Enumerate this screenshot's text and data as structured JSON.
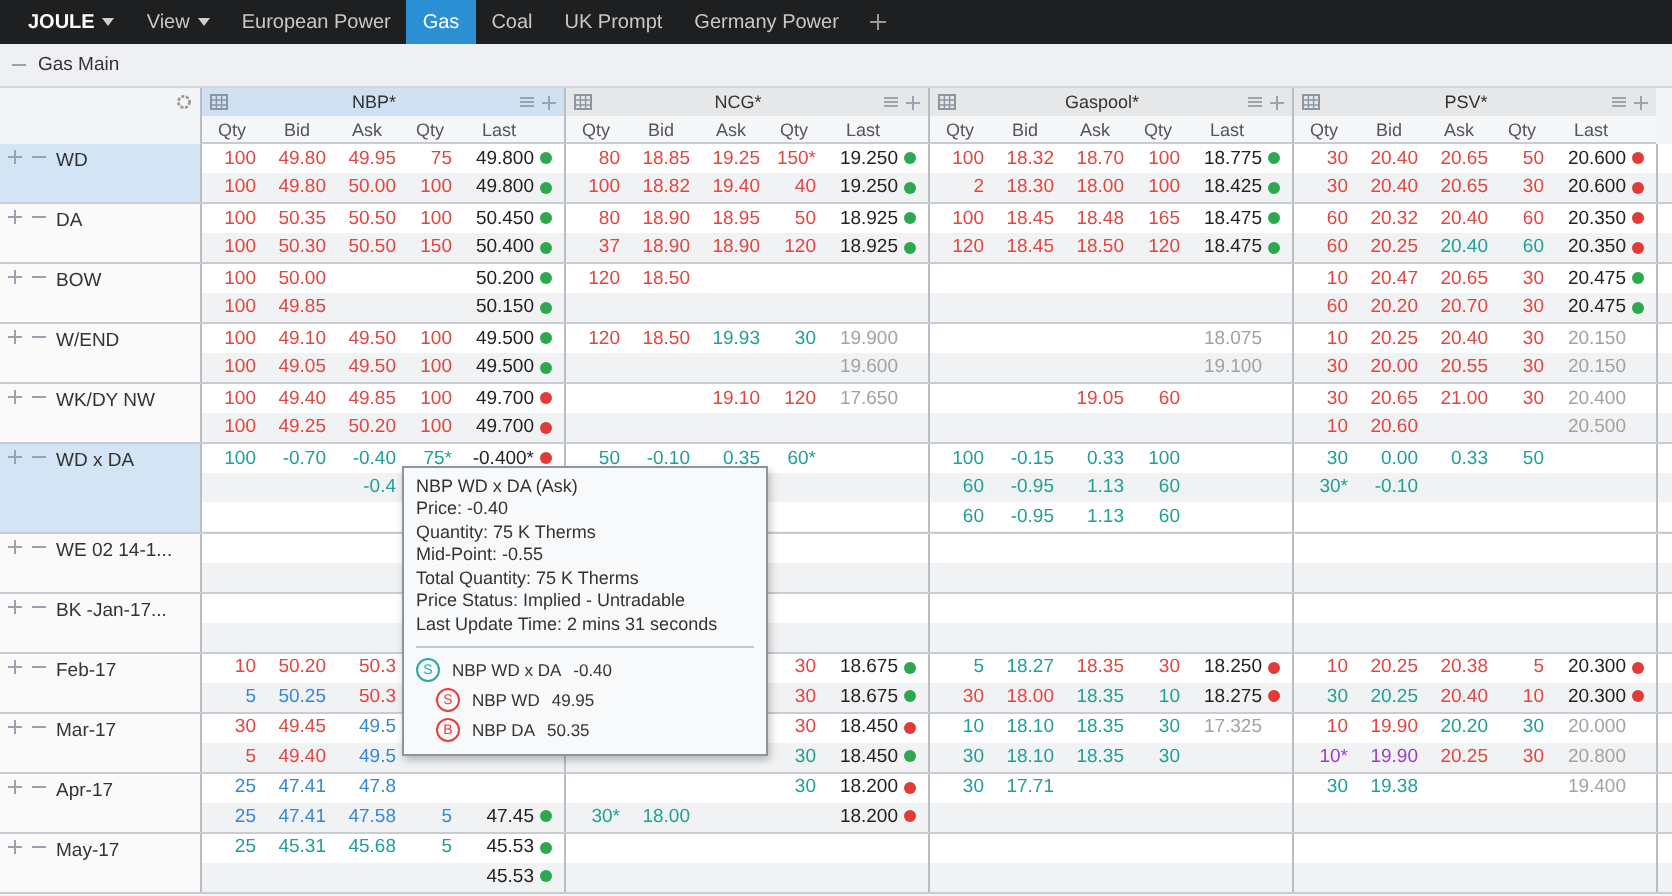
{
  "nav": [
    {
      "label": "JOULE",
      "kind": "brand",
      "selected": false
    },
    {
      "label": "View",
      "kind": "menu",
      "selected": false
    },
    {
      "label": "European Power",
      "kind": "tab",
      "selected": false
    },
    {
      "label": "Gas",
      "kind": "tab",
      "selected": true
    },
    {
      "label": "Coal",
      "kind": "tab",
      "selected": false
    },
    {
      "label": "UK Prompt",
      "kind": "tab",
      "selected": false
    },
    {
      "label": "Germany Power",
      "kind": "tab",
      "selected": false
    }
  ],
  "section": {
    "title": "Gas Main",
    "expanded": true
  },
  "hubs": [
    {
      "name": "NBP*",
      "selected": true,
      "columns": [
        "Qty",
        "Bid",
        "Ask",
        "Qty",
        "Last"
      ]
    },
    {
      "name": "NCG*",
      "selected": false,
      "columns": [
        "Qty",
        "Bid",
        "Ask",
        "Qty",
        "Last"
      ]
    },
    {
      "name": "Gaspool*",
      "selected": false,
      "columns": [
        "Qty",
        "Bid",
        "Ask",
        "Qty",
        "Last"
      ]
    },
    {
      "name": "PSV*",
      "selected": false,
      "columns": [
        "Qty",
        "Bid",
        "Ask",
        "Qty",
        "Last"
      ]
    }
  ],
  "products": [
    {
      "label": "WD",
      "selected": true,
      "rows": [
        [
          {
            "bid": {
              "qty": "100",
              "price": "49.80",
              "color": "#e3453f"
            },
            "ask": {
              "price": "49.95",
              "qty": "75",
              "color": "#e3453f"
            },
            "last": {
              "price": "49.800",
              "color": "#222222",
              "rising": true
            }
          },
          {
            "bid": {
              "qty": "80",
              "price": "18.85",
              "color": "#e3453f"
            },
            "ask": {
              "price": "19.25",
              "qty": "150*",
              "color": "#e3453f"
            },
            "last": {
              "price": "19.250",
              "color": "#222222",
              "rising": true
            }
          },
          {
            "bid": {
              "qty": "100",
              "price": "18.32",
              "color": "#e3453f"
            },
            "ask": {
              "price": "18.70",
              "qty": "100",
              "color": "#e3453f"
            },
            "last": {
              "price": "18.775",
              "color": "#222222",
              "rising": true
            }
          },
          {
            "bid": {
              "qty": "30",
              "price": "20.40",
              "color": "#e3453f"
            },
            "ask": {
              "price": "20.65",
              "qty": "50",
              "color": "#e3453f"
            },
            "last": {
              "price": "20.600",
              "color": "#222222",
              "rising": false
            }
          }
        ],
        [
          {
            "bid": {
              "qty": "100",
              "price": "49.80",
              "color": "#e3453f"
            },
            "ask": {
              "price": "50.00",
              "qty": "100",
              "color": "#e3453f"
            },
            "last": {
              "price": "49.800",
              "color": "#222222",
              "rising": true
            }
          },
          {
            "bid": {
              "qty": "100",
              "price": "18.82",
              "color": "#e3453f"
            },
            "ask": {
              "price": "19.40",
              "qty": "40",
              "color": "#e3453f"
            },
            "last": {
              "price": "19.250",
              "color": "#222222",
              "rising": true
            }
          },
          {
            "bid": {
              "qty": "2",
              "price": "18.30",
              "color": "#e3453f"
            },
            "ask": {
              "price": "18.00",
              "qty": "100",
              "color": "#e3453f"
            },
            "last": {
              "price": "18.425",
              "color": "#222222",
              "rising": true
            }
          },
          {
            "bid": {
              "qty": "30",
              "price": "20.40",
              "color": "#e3453f"
            },
            "ask": {
              "price": "20.65",
              "qty": "30",
              "color": "#e3453f"
            },
            "last": {
              "price": "20.600",
              "color": "#222222",
              "rising": false
            }
          }
        ]
      ]
    },
    {
      "label": "DA",
      "selected": false,
      "rows": [
        [
          {
            "bid": {
              "qty": "100",
              "price": "50.35",
              "color": "#e3453f"
            },
            "ask": {
              "price": "50.50",
              "qty": "100",
              "color": "#e3453f"
            },
            "last": {
              "price": "50.450",
              "color": "#222222",
              "rising": true
            }
          },
          {
            "bid": {
              "qty": "80",
              "price": "18.90",
              "color": "#e3453f"
            },
            "ask": {
              "price": "18.95",
              "qty": "50",
              "color": "#e3453f"
            },
            "last": {
              "price": "18.925",
              "color": "#222222",
              "rising": true
            }
          },
          {
            "bid": {
              "qty": "100",
              "price": "18.45",
              "color": "#e3453f"
            },
            "ask": {
              "price": "18.48",
              "qty": "165",
              "color": "#e3453f"
            },
            "last": {
              "price": "18.475",
              "color": "#222222",
              "rising": true
            }
          },
          {
            "bid": {
              "qty": "60",
              "price": "20.32",
              "color": "#e3453f"
            },
            "ask": {
              "price": "20.40",
              "qty": "60",
              "color": "#e3453f"
            },
            "last": {
              "price": "20.350",
              "color": "#222222",
              "rising": false
            }
          }
        ],
        [
          {
            "bid": {
              "qty": "100",
              "price": "50.30",
              "color": "#e3453f"
            },
            "ask": {
              "price": "50.50",
              "qty": "150",
              "color": "#e3453f"
            },
            "last": {
              "price": "50.400",
              "color": "#222222",
              "rising": true
            }
          },
          {
            "bid": {
              "qty": "37",
              "price": "18.90",
              "color": "#e3453f"
            },
            "ask": {
              "price": "18.90",
              "qty": "120",
              "color": "#e3453f"
            },
            "last": {
              "price": "18.925",
              "color": "#222222",
              "rising": true
            }
          },
          {
            "bid": {
              "qty": "120",
              "price": "18.45",
              "color": "#e3453f"
            },
            "ask": {
              "price": "18.50",
              "qty": "120",
              "color": "#e3453f"
            },
            "last": {
              "price": "18.475",
              "color": "#222222",
              "rising": true
            }
          },
          {
            "bid": {
              "qty": "60",
              "price": "20.25",
              "color": "#e3453f"
            },
            "ask": {
              "price": "20.40",
              "qty": "60",
              "color": "#1f9f98"
            },
            "last": {
              "price": "20.350",
              "color": "#222222",
              "rising": false
            }
          }
        ]
      ]
    },
    {
      "label": "BOW",
      "selected": false,
      "rows": [
        [
          {
            "bid": {
              "qty": "100",
              "price": "50.00",
              "color": "#e3453f"
            },
            "last": {
              "price": "50.200",
              "color": "#222222",
              "rising": true
            }
          },
          {
            "bid": {
              "qty": "120",
              "price": "18.50",
              "color": "#e3453f"
            }
          },
          null,
          {
            "bid": {
              "qty": "10",
              "price": "20.47",
              "color": "#e3453f"
            },
            "ask": {
              "price": "20.65",
              "qty": "30",
              "color": "#e3453f"
            },
            "last": {
              "price": "20.475",
              "color": "#222222",
              "rising": true
            }
          }
        ],
        [
          {
            "bid": {
              "qty": "100",
              "price": "49.85",
              "color": "#e3453f"
            },
            "last": {
              "price": "50.150",
              "color": "#222222",
              "rising": true
            }
          },
          null,
          null,
          {
            "bid": {
              "qty": "60",
              "price": "20.20",
              "color": "#e3453f"
            },
            "ask": {
              "price": "20.70",
              "qty": "30",
              "color": "#e3453f"
            },
            "last": {
              "price": "20.475",
              "color": "#222222",
              "rising": true
            }
          }
        ]
      ]
    },
    {
      "label": "W/END",
      "selected": false,
      "rows": [
        [
          {
            "bid": {
              "qty": "100",
              "price": "49.10",
              "color": "#e3453f"
            },
            "ask": {
              "price": "49.50",
              "qty": "100",
              "color": "#e3453f"
            },
            "last": {
              "price": "49.500",
              "color": "#222222",
              "rising": true
            }
          },
          {
            "bid": {
              "qty": "120",
              "price": "18.50",
              "color": "#e3453f"
            },
            "ask": {
              "price": "19.93",
              "qty": "30",
              "color": "#1f9f98"
            },
            "last": {
              "price": "19.900",
              "color": "#a2a2a2"
            }
          },
          {
            "last": {
              "price": "18.075",
              "color": "#a2a2a2"
            }
          },
          {
            "bid": {
              "qty": "10",
              "price": "20.25",
              "color": "#e3453f"
            },
            "ask": {
              "price": "20.40",
              "qty": "30",
              "color": "#e3453f"
            },
            "last": {
              "price": "20.150",
              "color": "#a2a2a2"
            }
          }
        ],
        [
          {
            "bid": {
              "qty": "100",
              "price": "49.05",
              "color": "#e3453f"
            },
            "ask": {
              "price": "49.50",
              "qty": "100",
              "color": "#e3453f"
            },
            "last": {
              "price": "49.500",
              "color": "#222222",
              "rising": true
            }
          },
          {
            "last": {
              "price": "19.600",
              "color": "#a2a2a2"
            }
          },
          {
            "last": {
              "price": "19.100",
              "color": "#a2a2a2"
            }
          },
          {
            "bid": {
              "qty": "30",
              "price": "20.00",
              "color": "#e3453f"
            },
            "ask": {
              "price": "20.55",
              "qty": "30",
              "color": "#e3453f"
            },
            "last": {
              "price": "20.150",
              "color": "#a2a2a2"
            }
          }
        ]
      ]
    },
    {
      "label": "WK/DY NW",
      "selected": false,
      "rows": [
        [
          {
            "bid": {
              "qty": "100",
              "price": "49.40",
              "color": "#e3453f"
            },
            "ask": {
              "price": "49.85",
              "qty": "100",
              "color": "#e3453f"
            },
            "last": {
              "price": "49.700",
              "color": "#222222",
              "rising": false
            }
          },
          {
            "ask": {
              "price": "19.10",
              "qty": "120",
              "color": "#e3453f"
            },
            "last": {
              "price": "17.650",
              "color": "#a2a2a2"
            }
          },
          {
            "ask": {
              "price": "19.05",
              "qty": "60",
              "color": "#e3453f"
            }
          },
          {
            "bid": {
              "qty": "30",
              "price": "20.65",
              "color": "#e3453f"
            },
            "ask": {
              "price": "21.00",
              "qty": "30",
              "color": "#e3453f"
            },
            "last": {
              "price": "20.400",
              "color": "#a2a2a2"
            }
          }
        ],
        [
          {
            "bid": {
              "qty": "100",
              "price": "49.25",
              "color": "#e3453f"
            },
            "ask": {
              "price": "50.20",
              "qty": "100",
              "color": "#e3453f"
            },
            "last": {
              "price": "49.700",
              "color": "#222222",
              "rising": false
            }
          },
          null,
          null,
          {
            "bid": {
              "qty": "10",
              "price": "20.60",
              "color": "#e3453f"
            },
            "last": {
              "price": "20.500",
              "color": "#a2a2a2"
            }
          }
        ]
      ]
    },
    {
      "label": "WD x DA",
      "selected": true,
      "rows": [
        [
          {
            "bid": {
              "qty": "100",
              "price": "-0.70",
              "color": "#1f9f98"
            },
            "ask": {
              "price": "-0.40",
              "qty": "75*",
              "color": "#1f9f98"
            },
            "last": {
              "price": "-0.400*",
              "color": "#222222",
              "rising": false
            }
          },
          {
            "bid": {
              "qty": "50",
              "price": "-0.10",
              "color": "#1f9f98"
            },
            "ask": {
              "price": "0.35",
              "qty": "60*",
              "color": "#1f9f98"
            }
          },
          {
            "bid": {
              "qty": "100",
              "price": "-0.15",
              "color": "#1f9f98"
            },
            "ask": {
              "price": "0.33",
              "qty": "100",
              "color": "#1f9f98"
            }
          },
          {
            "bid": {
              "qty": "30",
              "price": "0.00",
              "color": "#1f9f98"
            },
            "ask": {
              "price": "0.33",
              "qty": "50",
              "color": "#1f9f98"
            }
          }
        ],
        [
          {
            "ask": {
              "price": "-0.4",
              "color": "#1f9f98"
            }
          },
          null,
          {
            "bid": {
              "qty": "60",
              "price": "-0.95",
              "color": "#1f9f98"
            },
            "ask": {
              "price": "1.13",
              "qty": "60",
              "color": "#1f9f98"
            }
          },
          {
            "bid": {
              "qty": "30*",
              "price": "-0.10",
              "color": "#1f9f98"
            }
          }
        ],
        [
          null,
          null,
          {
            "bid": {
              "qty": "60",
              "price": "-0.95",
              "color": "#1f9f98"
            },
            "ask": {
              "price": "1.13",
              "qty": "60",
              "color": "#1f9f98"
            }
          },
          null
        ]
      ]
    },
    {
      "label": "WE 02 14-1...",
      "selected": false,
      "rows": [
        [
          null,
          null,
          null,
          null
        ],
        [
          null,
          null,
          null,
          null
        ]
      ]
    },
    {
      "label": "BK -Jan-17...",
      "selected": false,
      "rows": [
        [
          null,
          null,
          null,
          null
        ],
        [
          null,
          null,
          null,
          null
        ]
      ]
    },
    {
      "label": "Feb-17",
      "selected": false,
      "rows": [
        [
          {
            "bid": {
              "qty": "10",
              "price": "50.20",
              "color": "#e3453f"
            },
            "ask": {
              "price": "50.3",
              "color": "#e3453f"
            }
          },
          {
            "ask": {
              "qty": "30",
              "color": "#e3453f"
            },
            "last": {
              "price": "18.675",
              "color": "#222222",
              "rising": true
            }
          },
          {
            "bid": {
              "qty": "5",
              "price": "18.27",
              "color": "#1f9f98"
            },
            "ask": {
              "price": "18.35",
              "qty": "30",
              "color": "#e3453f"
            },
            "last": {
              "price": "18.250",
              "color": "#222222",
              "rising": false
            }
          },
          {
            "bid": {
              "qty": "10",
              "price": "20.25",
              "color": "#e3453f"
            },
            "ask": {
              "price": "20.38",
              "qty": "5",
              "color": "#e3453f"
            },
            "last": {
              "price": "20.300",
              "color": "#222222",
              "rising": false
            }
          }
        ],
        [
          {
            "bid": {
              "qty": "5",
              "price": "50.25",
              "color": "#3488dc"
            },
            "ask": {
              "price": "50.3",
              "color": "#e3453f"
            }
          },
          {
            "ask": {
              "qty": "30",
              "color": "#e3453f"
            },
            "last": {
              "price": "18.675",
              "color": "#222222",
              "rising": true
            }
          },
          {
            "bid": {
              "qty": "30",
              "price": "18.00",
              "color": "#e3453f"
            },
            "ask": {
              "price": "18.35",
              "qty": "10",
              "color": "#1f9f98"
            },
            "last": {
              "price": "18.275",
              "color": "#222222",
              "rising": false
            }
          },
          {
            "bid": {
              "qty": "30",
              "price": "20.25",
              "color": "#1f9f98"
            },
            "ask": {
              "price": "20.40",
              "qty": "10",
              "color": "#e3453f"
            },
            "last": {
              "price": "20.300",
              "color": "#222222",
              "rising": false
            }
          }
        ]
      ]
    },
    {
      "label": "Mar-17",
      "selected": false,
      "rows": [
        [
          {
            "bid": {
              "qty": "30",
              "price": "49.45",
              "color": "#e3453f"
            },
            "ask": {
              "price": "49.5",
              "color": "#3488dc"
            }
          },
          {
            "ask": {
              "qty": "30",
              "color": "#e3453f"
            },
            "last": {
              "price": "18.450",
              "color": "#222222",
              "rising": false
            }
          },
          {
            "bid": {
              "qty": "10",
              "price": "18.10",
              "color": "#1f9f98"
            },
            "ask": {
              "price": "18.35",
              "qty": "30",
              "color": "#1f9f98"
            },
            "last": {
              "price": "17.325",
              "color": "#a2a2a2"
            }
          },
          {
            "bid": {
              "qty": "10",
              "price": "19.90",
              "color": "#e3453f"
            },
            "ask": {
              "price": "20.20",
              "qty": "30",
              "color": "#1f9f98"
            },
            "last": {
              "price": "20.000",
              "color": "#a2a2a2"
            }
          }
        ],
        [
          {
            "bid": {
              "qty": "5",
              "price": "49.40",
              "color": "#e3453f"
            },
            "ask": {
              "price": "49.5",
              "color": "#3488dc"
            }
          },
          {
            "ask": {
              "qty": "30",
              "color": "#1f9f98"
            },
            "last": {
              "price": "18.450",
              "color": "#222222",
              "rising": true
            }
          },
          {
            "bid": {
              "qty": "30",
              "price": "18.10",
              "color": "#1f9f98"
            },
            "ask": {
              "price": "18.35",
              "qty": "30",
              "color": "#1f9f98"
            }
          },
          {
            "bid": {
              "qty": "10*",
              "price": "19.90",
              "color": "#9b3fc8"
            },
            "ask": {
              "price": "20.25",
              "qty": "30",
              "color": "#e3453f"
            },
            "last": {
              "price": "20.800",
              "color": "#a2a2a2"
            }
          }
        ]
      ]
    },
    {
      "label": "Apr-17",
      "selected": false,
      "rows": [
        [
          {
            "bid": {
              "qty": "25",
              "price": "47.41",
              "color": "#3488dc"
            },
            "ask": {
              "price": "47.8",
              "color": "#3488dc"
            }
          },
          {
            "ask": {
              "qty": "30",
              "color": "#1f9f98"
            },
            "last": {
              "price": "18.200",
              "color": "#222222",
              "rising": false
            }
          },
          {
            "bid": {
              "qty": "30",
              "price": "17.71",
              "color": "#1f9f98"
            }
          },
          {
            "bid": {
              "qty": "30",
              "price": "19.38",
              "color": "#1f9f98"
            },
            "last": {
              "price": "19.400",
              "color": "#a2a2a2"
            }
          }
        ],
        [
          {
            "bid": {
              "qty": "25",
              "price": "47.41",
              "color": "#3488dc"
            },
            "ask": {
              "price": "47.58",
              "qty": "5",
              "color": "#3488dc"
            },
            "last": {
              "price": "47.45",
              "color": "#222222",
              "rising": true
            }
          },
          {
            "bid": {
              "qty": "30*",
              "price": "18.00",
              "color": "#1f9f98"
            },
            "last": {
              "price": "18.200",
              "color": "#222222",
              "rising": false
            }
          },
          null,
          null
        ]
      ]
    },
    {
      "label": "May-17",
      "selected": false,
      "rows": [
        [
          {
            "bid": {
              "qty": "25",
              "price": "45.31",
              "color": "#1f9f98"
            },
            "ask": {
              "price": "45.68",
              "qty": "5",
              "color": "#1f9f98"
            },
            "last": {
              "price": "45.53",
              "color": "#222222",
              "rising": true
            }
          },
          null,
          null,
          null
        ],
        [
          {
            "last": {
              "price": "45.53",
              "color": "#222222",
              "rising": true
            }
          },
          null,
          null,
          null
        ]
      ]
    }
  ],
  "tooltip": {
    "title": "NBP WD x DA (Ask)",
    "lines": [
      "Price: -0.40",
      "Quantity: 75 K Therms",
      "Mid-Point: -0.55",
      "Total Quantity: 75 K Therms",
      "Price Status: Implied - Untradable",
      "Last Update Time: 2 mins 31 seconds"
    ],
    "legs": [
      {
        "badge": "S",
        "color": "#2aa9a0",
        "name": "NBP WD x DA",
        "value": "-0.40",
        "children": [
          {
            "badge": "S",
            "color": "#e8403a",
            "name": "NBP WD",
            "value": "49.95"
          },
          {
            "badge": "B",
            "color": "#e8403a",
            "name": "NBP DA",
            "value": "50.35"
          }
        ]
      }
    ]
  }
}
